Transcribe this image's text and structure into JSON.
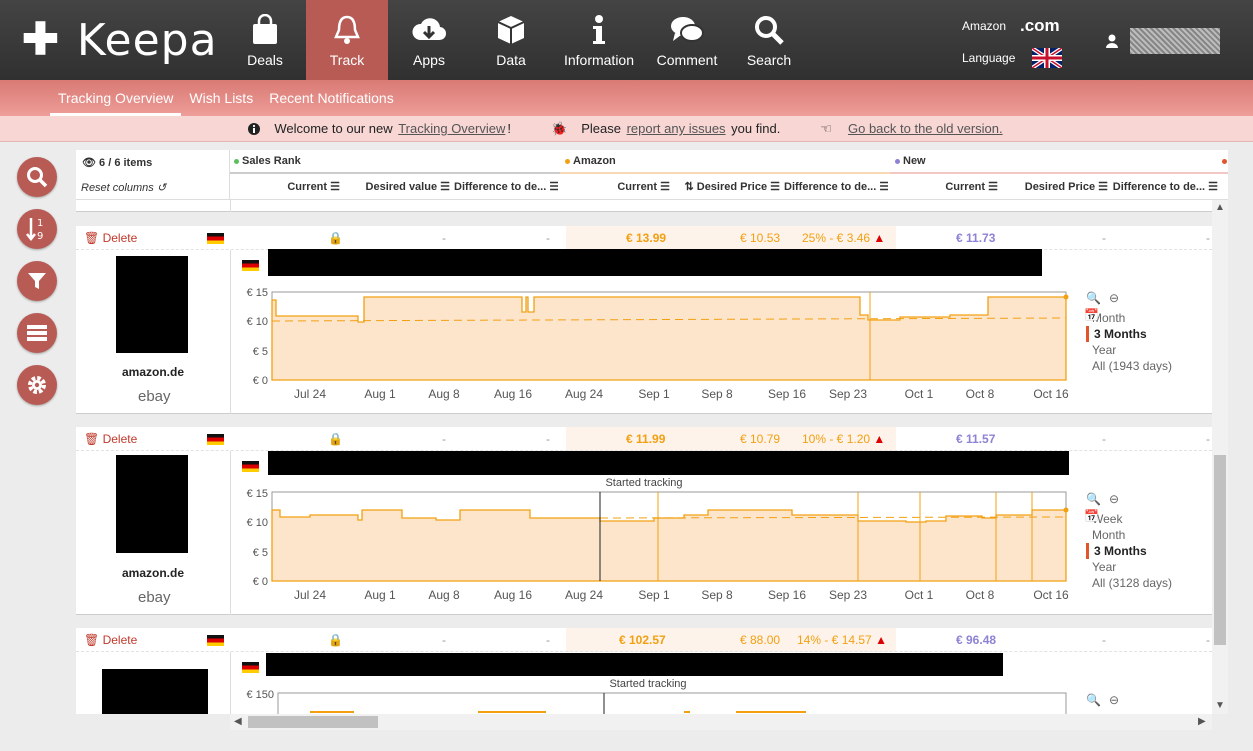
{
  "brand": {
    "name": "Keepa"
  },
  "nav": [
    {
      "label": "Deals",
      "icon": "shopping-bag-icon"
    },
    {
      "label": "Track",
      "icon": "bell-icon",
      "active": true
    },
    {
      "label": "Apps",
      "icon": "cloud-download-icon"
    },
    {
      "label": "Data",
      "icon": "cube-icon"
    },
    {
      "label": "Information",
      "icon": "info-icon"
    },
    {
      "label": "Comment",
      "icon": "comment-icon"
    },
    {
      "label": "Search",
      "icon": "search-icon"
    }
  ],
  "top_right": {
    "amazon_label": "Amazon",
    "domain": ".com",
    "language_label": "Language"
  },
  "subnav": [
    "Tracking Overview",
    "Wish Lists",
    "Recent Notifications"
  ],
  "welcome": {
    "pre1": "Welcome to our new ",
    "link1": "Tracking Overview",
    "post1": "!",
    "pre2": "Please ",
    "link2": "report any issues",
    "post2": " you find.",
    "link3": "Go back to the old version."
  },
  "grid_head": {
    "items_count": "6 / 6 items",
    "reset_columns": "Reset columns",
    "groups": [
      "Sales Rank",
      "Amazon",
      "New"
    ],
    "columns": [
      "Current",
      "Desired value",
      "Difference to de...",
      "Current",
      "Desired Price",
      "Difference to de...",
      "Current",
      "Desired Price",
      "Difference to de..."
    ]
  },
  "colors": {
    "amazon": "#f2a012",
    "new": "#8c82d6",
    "sales_rank": "#5bbf5b",
    "accent": "#b85b55"
  },
  "cards": [
    {
      "delete": "Delete",
      "amazon_current": "€ 13.99",
      "amazon_desired": "€ 10.53",
      "amazon_diff": "25% - € 3.46",
      "new_current": "€ 11.73",
      "brand": "amazon.de",
      "ebay": "ebay",
      "y_ticks": [
        "€ 15",
        "€ 10",
        "€ 5",
        "€ 0"
      ],
      "x_ticks": [
        "Jul 24",
        "Aug 1",
        "Aug 8",
        "Aug 16",
        "Aug 24",
        "Sep 1",
        "Sep 8",
        "Sep 16",
        "Sep 23",
        "Oct 1",
        "Oct 8",
        "Oct 16"
      ],
      "ranges": [
        "Month",
        "3 Months",
        "Year",
        "All (1943 days)"
      ],
      "selected_range": "3 Months"
    },
    {
      "delete": "Delete",
      "amazon_current": "€ 11.99",
      "amazon_desired": "€ 10.79",
      "amazon_diff": "10% - € 1.20",
      "new_current": "€ 11.57",
      "brand": "amazon.de",
      "ebay": "ebay",
      "annotation": "Started tracking",
      "y_ticks": [
        "€ 15",
        "€ 10",
        "€ 5",
        "€ 0"
      ],
      "x_ticks": [
        "Jul 24",
        "Aug 1",
        "Aug 8",
        "Aug 16",
        "Aug 24",
        "Sep 1",
        "Sep 8",
        "Sep 16",
        "Sep 23",
        "Oct 1",
        "Oct 8",
        "Oct 16"
      ],
      "ranges": [
        "Week",
        "Month",
        "3 Months",
        "Year",
        "All (3128 days)"
      ],
      "selected_range": "3 Months"
    },
    {
      "delete": "Delete",
      "amazon_current": "€ 102.57",
      "amazon_desired": "€ 88.00",
      "amazon_diff": "14% - € 14.57",
      "new_current": "€ 96.48",
      "annotation": "Started tracking",
      "y_ticks": [
        "€ 150"
      ]
    }
  ],
  "dash": "-"
}
